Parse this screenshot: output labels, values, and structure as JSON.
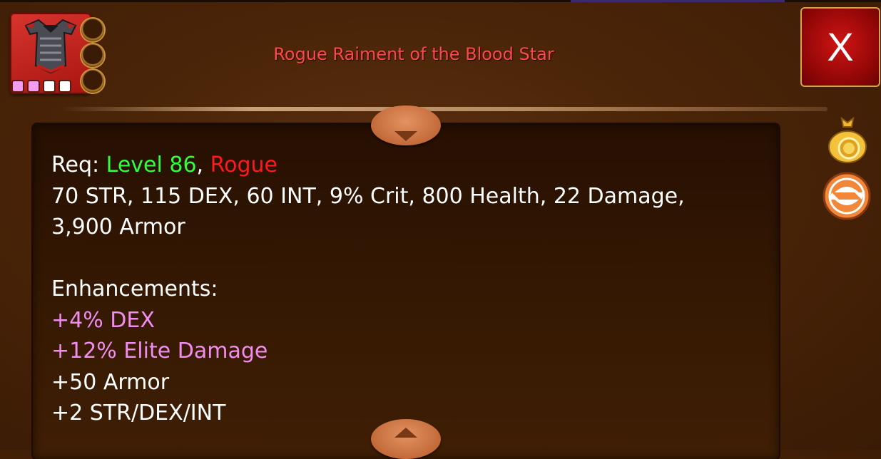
{
  "item": {
    "name": "Rogue Raiment of the Blood Star",
    "icon": "chest-armor-icon",
    "gem_slots": [
      "#f49cf2",
      "#f49cf2",
      "#ffffff",
      "#ffffff"
    ]
  },
  "controls": {
    "close_label": "X",
    "gold_icon": "gold-bag-icon",
    "swap_icon": "swap-icon",
    "scroll_up_icon": "arrow-down-icon",
    "scroll_down_icon": "arrow-up-icon"
  },
  "requirements": {
    "prefix": "Req: ",
    "level": "Level 86",
    "separator": ", ",
    "class": "Rogue",
    "level_color": "#30ff3c",
    "class_color": "#ff1a1a"
  },
  "stats": {
    "line1": "70 STR, 115 DEX, 60 INT, 9% Crit, 800 Health, 22 Damage,",
    "line2": "3,900 Armor"
  },
  "enhancements": {
    "header": "Enhancements:",
    "magic_color": "#f08cf0",
    "items": [
      {
        "text": "+4% DEX",
        "magic": true
      },
      {
        "text": "+12% Elite Damage",
        "magic": true
      },
      {
        "text": "+50 Armor",
        "magic": false
      },
      {
        "text": "+2 STR/DEX/INT",
        "magic": false
      }
    ]
  }
}
